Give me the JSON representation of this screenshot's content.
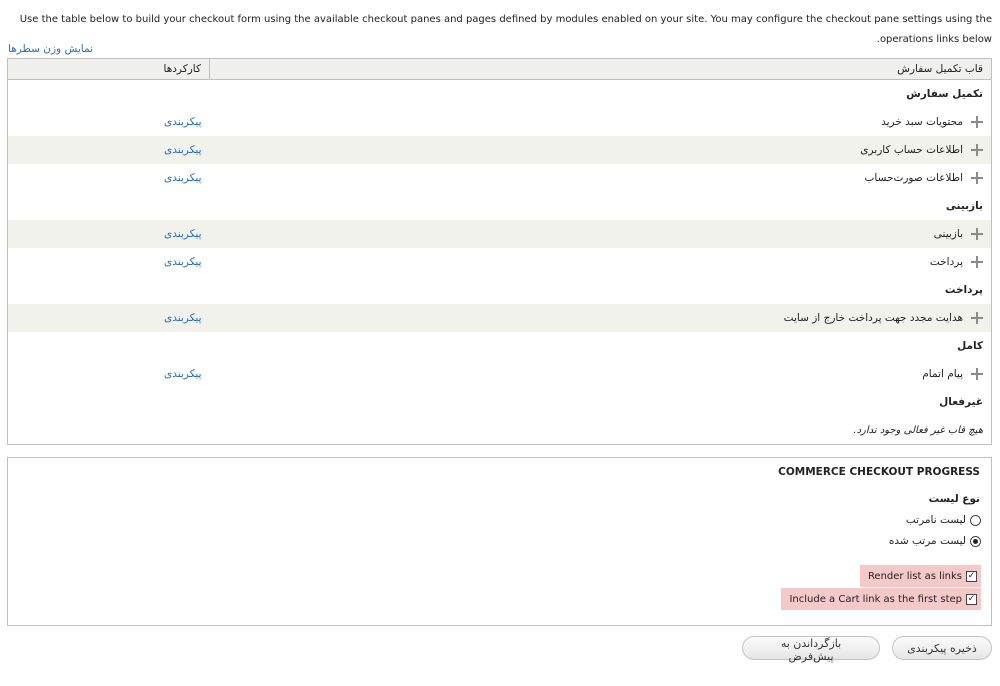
{
  "description": "Use the table below to build your checkout form using the available checkout panes and pages defined by modules enabled on your site. You may configure the checkout pane settings using the operations links below.",
  "show_row_weights": "نمایش وزن سطرها",
  "table": {
    "col_pane": "قاب تکمیل سفارش",
    "col_operations": "کارکردها",
    "configure_label": "پیکربندی",
    "regions": [
      {
        "title": "تکمیل سفارش",
        "panes": [
          "محتویات سبد خرید",
          "اطلاعات حساب کاربری",
          "اطلاعات صورت‌حساب"
        ]
      },
      {
        "title": "بازبینی",
        "panes": [
          "بازبینی",
          "پرداخت"
        ]
      },
      {
        "title": "پرداخت",
        "panes": [
          "هدایت مجدد جهت پرداخت خارج از سایت"
        ]
      },
      {
        "title": "کامل",
        "panes": [
          "پیام اتمام"
        ]
      },
      {
        "title": "غیرفعال",
        "empty": "هیچ قاب غیر فعالی وجود ندارد."
      }
    ]
  },
  "progress": {
    "legend": "COMMERCE CHECKOUT PROGRESS",
    "list_type_label": "نوع لیست",
    "options": [
      {
        "label": "لیست نامرتب",
        "checked": false
      },
      {
        "label": "لیست مرتب شده",
        "checked": true
      }
    ],
    "render_links": {
      "label": "Render list as links",
      "checked": true
    },
    "cart_link": {
      "label": "Include a Cart link as the first step",
      "checked": true
    }
  },
  "actions": {
    "save": "ذخیره پیکربندی",
    "reset": "بازگرداندن به پیش‌فرض"
  }
}
